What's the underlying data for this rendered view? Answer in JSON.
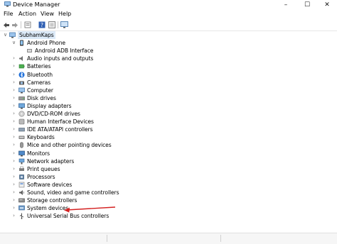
{
  "window": {
    "title": "Device Manager",
    "controls": {
      "minimize": "–",
      "maximize": "☐",
      "close": "✕"
    }
  },
  "menu": [
    "File",
    "Action",
    "View",
    "Help"
  ],
  "toolbar": {
    "buttons": [
      "back-arrow-icon",
      "forward-arrow-icon",
      "properties-icon",
      "help-icon",
      "update-driver-icon",
      "monitor-icon"
    ]
  },
  "tree": {
    "root": "SubhamKaps",
    "expanded_category": {
      "label": "Android Phone",
      "children": [
        "Android ADB Interface"
      ]
    },
    "categories": [
      "Audio inputs and outputs",
      "Batteries",
      "Bluetooth",
      "Cameras",
      "Computer",
      "Disk drives",
      "Display adapters",
      "DVD/CD-ROM drives",
      "Human Interface Devices",
      "IDE ATA/ATAPI controllers",
      "Keyboards",
      "Mice and other pointing devices",
      "Monitors",
      "Network adapters",
      "Print queues",
      "Processors",
      "Software devices",
      "Sound, video and game controllers",
      "Storage controllers",
      "System devices",
      "Universal Serial Bus controllers"
    ]
  },
  "annotation": {
    "highlighted_item": "System devices",
    "arrow_color": "#d42020"
  },
  "colors": {
    "selection": "#dceaf8",
    "icon_blue": "#3a7bd5"
  }
}
